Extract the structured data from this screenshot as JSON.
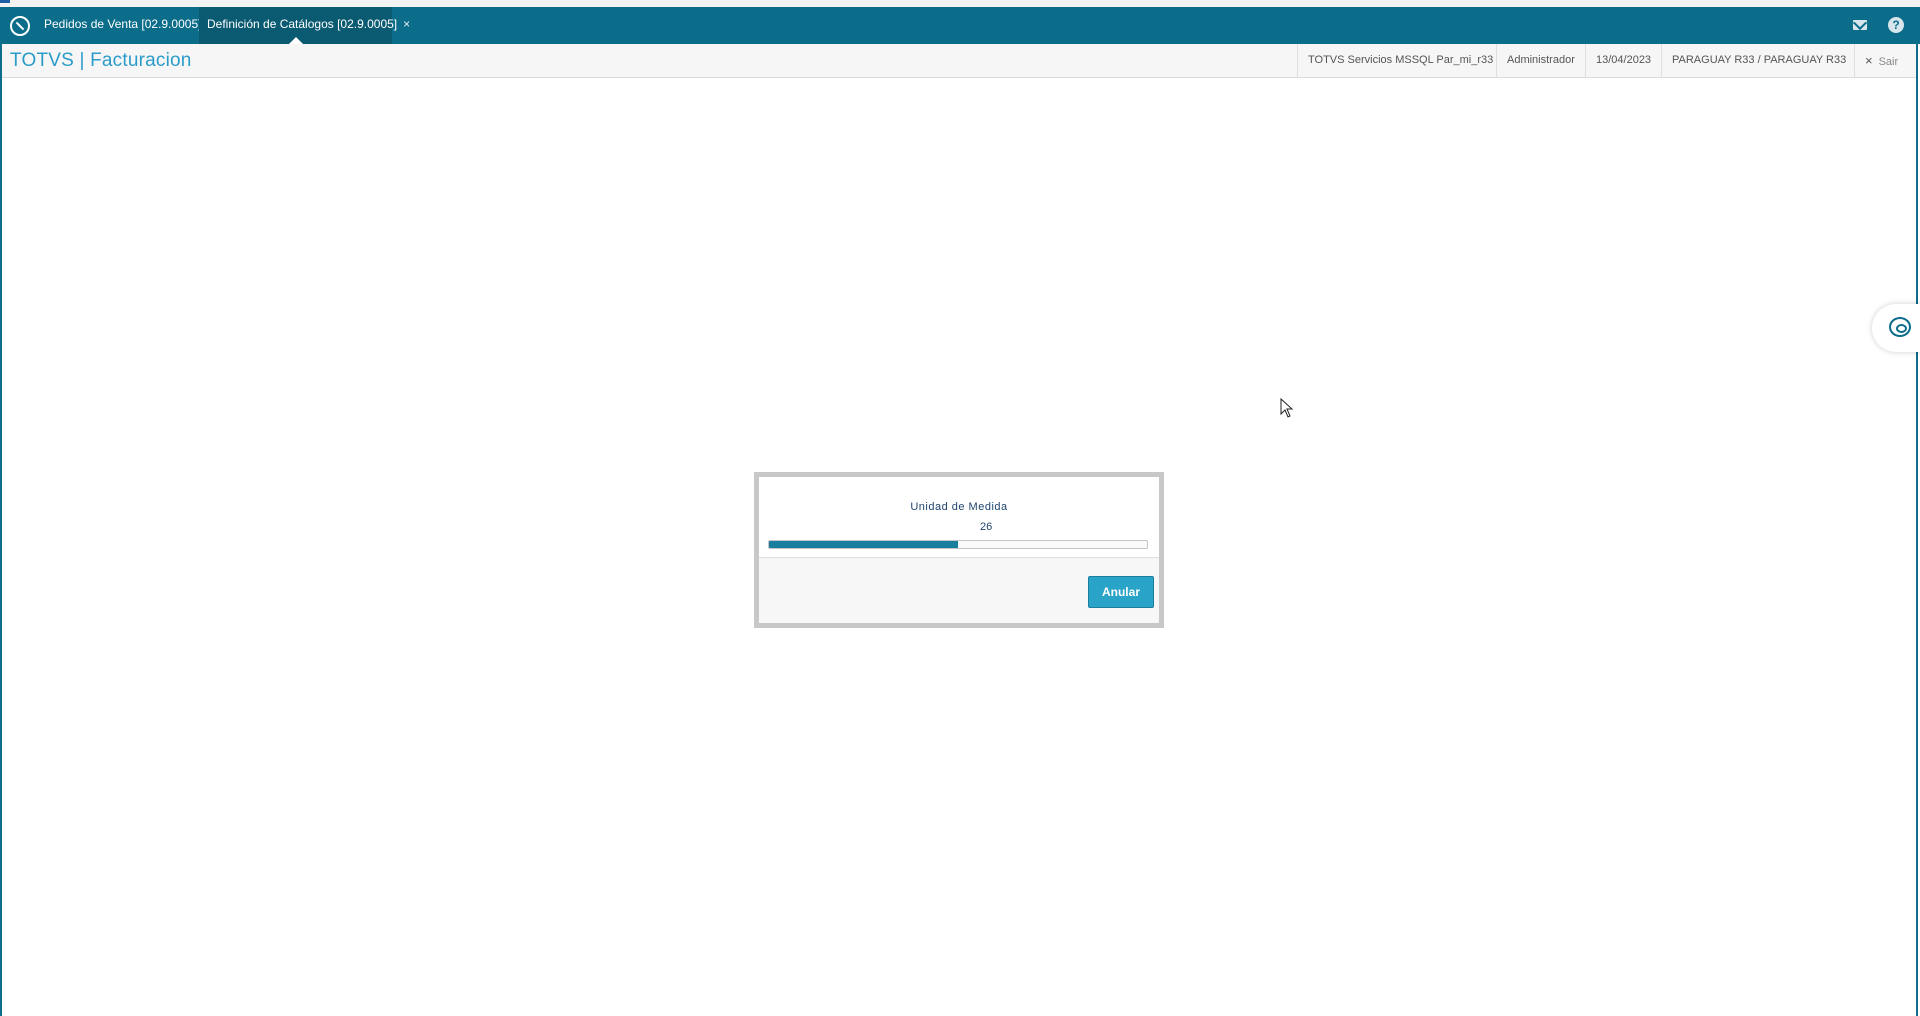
{
  "tabs": [
    {
      "label": "Pedidos de Venta [02.9.0005]",
      "close": "×"
    },
    {
      "label": "Definición de Catálogos [02.9.0005]",
      "close": "×"
    }
  ],
  "header": {
    "brand": "TOTVS | Facturacion",
    "environment": "TOTVS Servicios MSSQL Par_mi_r33",
    "user": "Administrador",
    "date": "13/04/2023",
    "company": "PARAGUAY R33 / PARAGUAY R33",
    "exit_label": "Sair",
    "exit_icon": "×"
  },
  "top_icons": {
    "help": "?"
  },
  "dialog": {
    "title": "Unidad de Medida",
    "count": "26",
    "progress": 0.5,
    "cancel_label": "Anular"
  },
  "colors": {
    "topbar": "#0b6d8a",
    "accent": "#2aa3c8",
    "progress_fill": "#1a7f9e",
    "brand": "#2a9cc9"
  }
}
